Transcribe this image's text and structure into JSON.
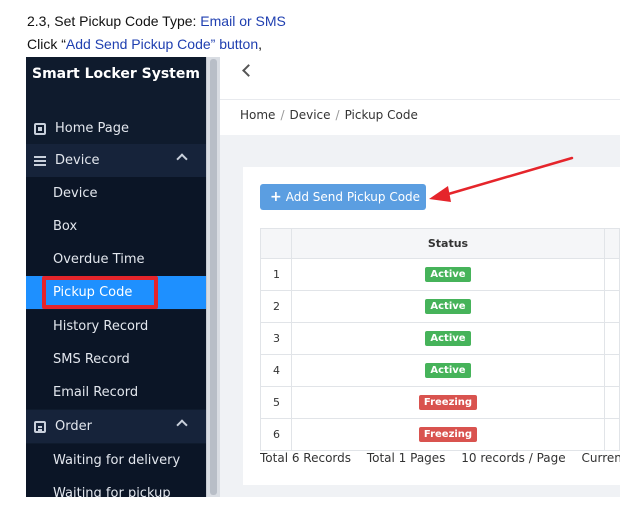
{
  "instructions": {
    "line1_prefix": "2.3, Set Pickup Code Type: ",
    "line1_highlight": "Email or SMS",
    "line2_prefix": "Click “",
    "line2_highlight": "Add Send Pickup Code” button",
    "line2_suffix": ","
  },
  "sidebar": {
    "brand": "Smart Locker System",
    "home": "Home Page",
    "device_group": "Device",
    "device_items": [
      "Device",
      "Box",
      "Overdue Time",
      "Pickup Code",
      "History Record",
      "SMS Record",
      "Email Record"
    ],
    "order_group": "Order",
    "order_items": [
      "Waiting for delivery",
      "Waiting for pickup"
    ]
  },
  "breadcrumb": [
    "Home",
    "Device",
    "Pickup Code"
  ],
  "breadcrumb_separator": "/",
  "add_button": {
    "icon": "+",
    "label": "Add Send Pickup Code"
  },
  "table": {
    "header": "Status",
    "rows": [
      {
        "index": "1",
        "status": "Active",
        "status_color": "#46b35a"
      },
      {
        "index": "2",
        "status": "Active",
        "status_color": "#46b35a"
      },
      {
        "index": "3",
        "status": "Active",
        "status_color": "#46b35a"
      },
      {
        "index": "4",
        "status": "Active",
        "status_color": "#46b35a"
      },
      {
        "index": "5",
        "status": "Freezing",
        "status_color": "#d9534f"
      },
      {
        "index": "6",
        "status": "Freezing",
        "status_color": "#d9534f"
      }
    ]
  },
  "pager": {
    "total_records": "Total 6 Records",
    "total_pages": "Total 1 Pages",
    "page_size": "10 records / Page",
    "current_page": "Current Pa"
  },
  "colors": {
    "sidebar_bg": "#0f1b2d",
    "active_item": "#1e90ff",
    "highlight_box": "#e5252b",
    "primary_button": "#5b9ee1",
    "annotation_arrow": "#e5252b"
  }
}
